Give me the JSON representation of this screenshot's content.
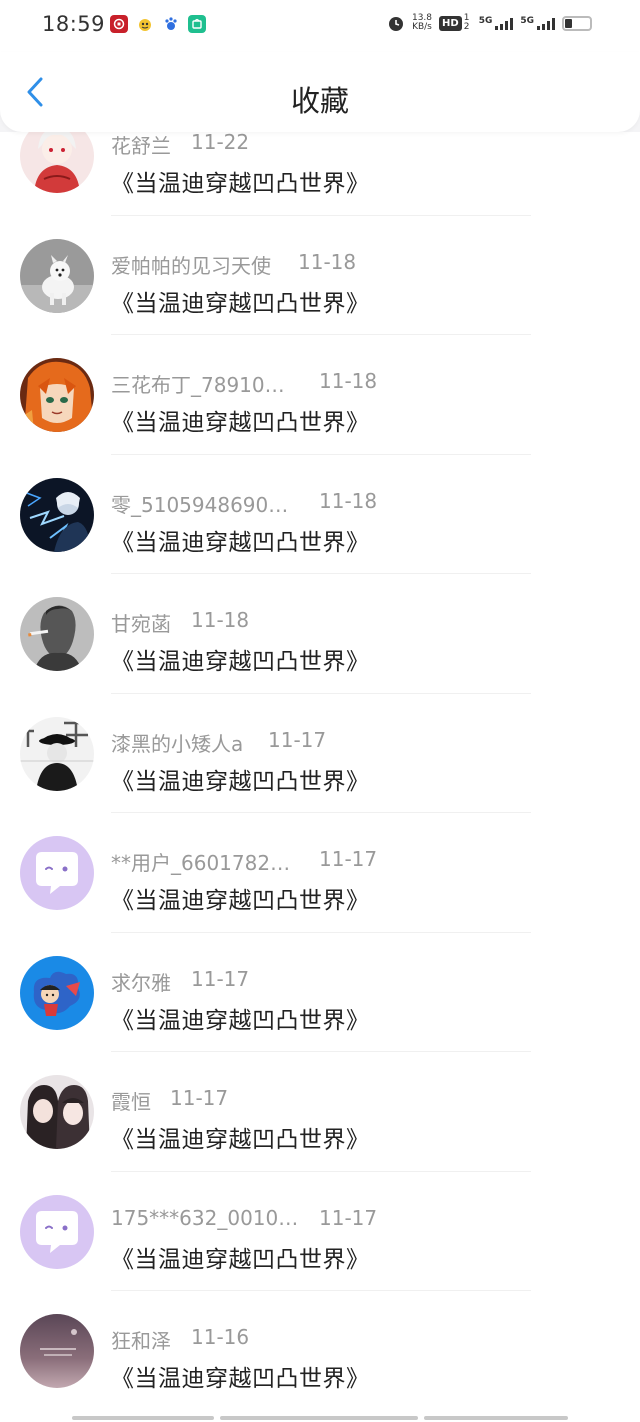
{
  "status_bar": {
    "time": "18:59",
    "net_speed": "13.8",
    "net_unit": "KB/s",
    "hd": "HD",
    "hd_sub": "1 2",
    "signal_1": "5G",
    "signal_2": "5G"
  },
  "header": {
    "title": "收藏",
    "back_icon": "chevron-left-icon"
  },
  "colors": {
    "accent": "#2f8fe8",
    "name_gray": "#999999",
    "title_dark": "#222222",
    "default_avatar": "#d8c6f3"
  },
  "favorites": [
    {
      "name": "花舒兰",
      "date": "11-22",
      "title": "《当温迪穿越凹凸世界》",
      "avatar": "pink-anime-girl-avatar"
    },
    {
      "name": "爱帕帕的见习天使",
      "date": "11-18",
      "title": "《当温迪穿越凹凸世界》",
      "avatar": "white-dog-avatar"
    },
    {
      "name": "三花布丁_78910…",
      "date": "11-18",
      "title": "《当温迪穿越凹凸世界》",
      "avatar": "orange-hair-anime-avatar"
    },
    {
      "name": "零_5105948690…",
      "date": "11-18",
      "title": "《当温迪穿越凹凸世界》",
      "avatar": "dark-lightning-anime-avatar"
    },
    {
      "name": "甘宛菡",
      "date": "11-18",
      "title": "《当温迪穿越凹凸世界》",
      "avatar": "smoking-man-avatar"
    },
    {
      "name": "漆黑的小矮人a",
      "date": "11-17",
      "title": "《当温迪穿越凹凸世界》",
      "avatar": "black-white-hat-avatar"
    },
    {
      "name": "**用户_6601782…",
      "date": "11-17",
      "title": "《当温迪穿越凹凸世界》",
      "avatar": "default-chat-bubble-avatar"
    },
    {
      "name": "求尔雅",
      "date": "11-17",
      "title": "《当温迪穿越凹凸世界》",
      "avatar": "blue-cartoon-avatar"
    },
    {
      "name": "霞恒",
      "date": "11-17",
      "title": "《当温迪穿越凹凸世界》",
      "avatar": "two-girls-avatar"
    },
    {
      "name": "175***632_0010…",
      "date": "11-17",
      "title": "《当温迪穿越凹凸世界》",
      "avatar": "default-chat-bubble-avatar"
    },
    {
      "name": "狂和泽",
      "date": "11-16",
      "title": "《当温迪穿越凹凸世界》",
      "avatar": "purple-sky-avatar"
    }
  ]
}
